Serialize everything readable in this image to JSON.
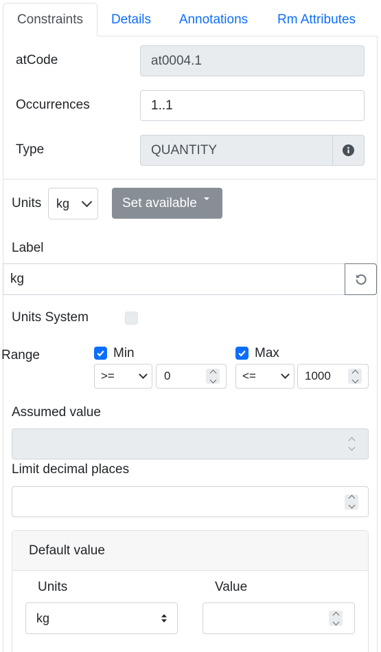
{
  "tabs": [
    {
      "label": "Constraints"
    },
    {
      "label": "Details"
    },
    {
      "label": "Annotations"
    },
    {
      "label": "Rm Attributes"
    }
  ],
  "fields": {
    "atcode_label": "atCode",
    "atcode_value": "at0004.1",
    "occurrences_label": "Occurrences",
    "occurrences_value": "1..1",
    "type_label": "Type",
    "type_value": "QUANTITY"
  },
  "units": {
    "label": "Units",
    "selected": "kg",
    "set_available_label": "Set available"
  },
  "label_field": {
    "label": "Label",
    "value": "kg"
  },
  "units_system": {
    "label": "Units System",
    "checked": false
  },
  "range": {
    "label": "Range",
    "min_label": "Min",
    "min_checked": true,
    "min_operator": ">=",
    "min_value": "0",
    "max_label": "Max",
    "max_checked": true,
    "max_operator": "<=",
    "max_value": "1000"
  },
  "assumed_value": {
    "label": "Assumed value",
    "value": ""
  },
  "limit_decimal": {
    "label": "Limit decimal places",
    "value": ""
  },
  "default_value": {
    "header": "Default value",
    "units_label": "Units",
    "units_selected": "kg",
    "value_label": "Value",
    "value": ""
  },
  "colors": {
    "link": "#0d6efd",
    "border": "#dee2e6",
    "readonly_bg": "#e9ecef",
    "button_grey": "#878e96",
    "checkbox": "#0d6efd"
  }
}
